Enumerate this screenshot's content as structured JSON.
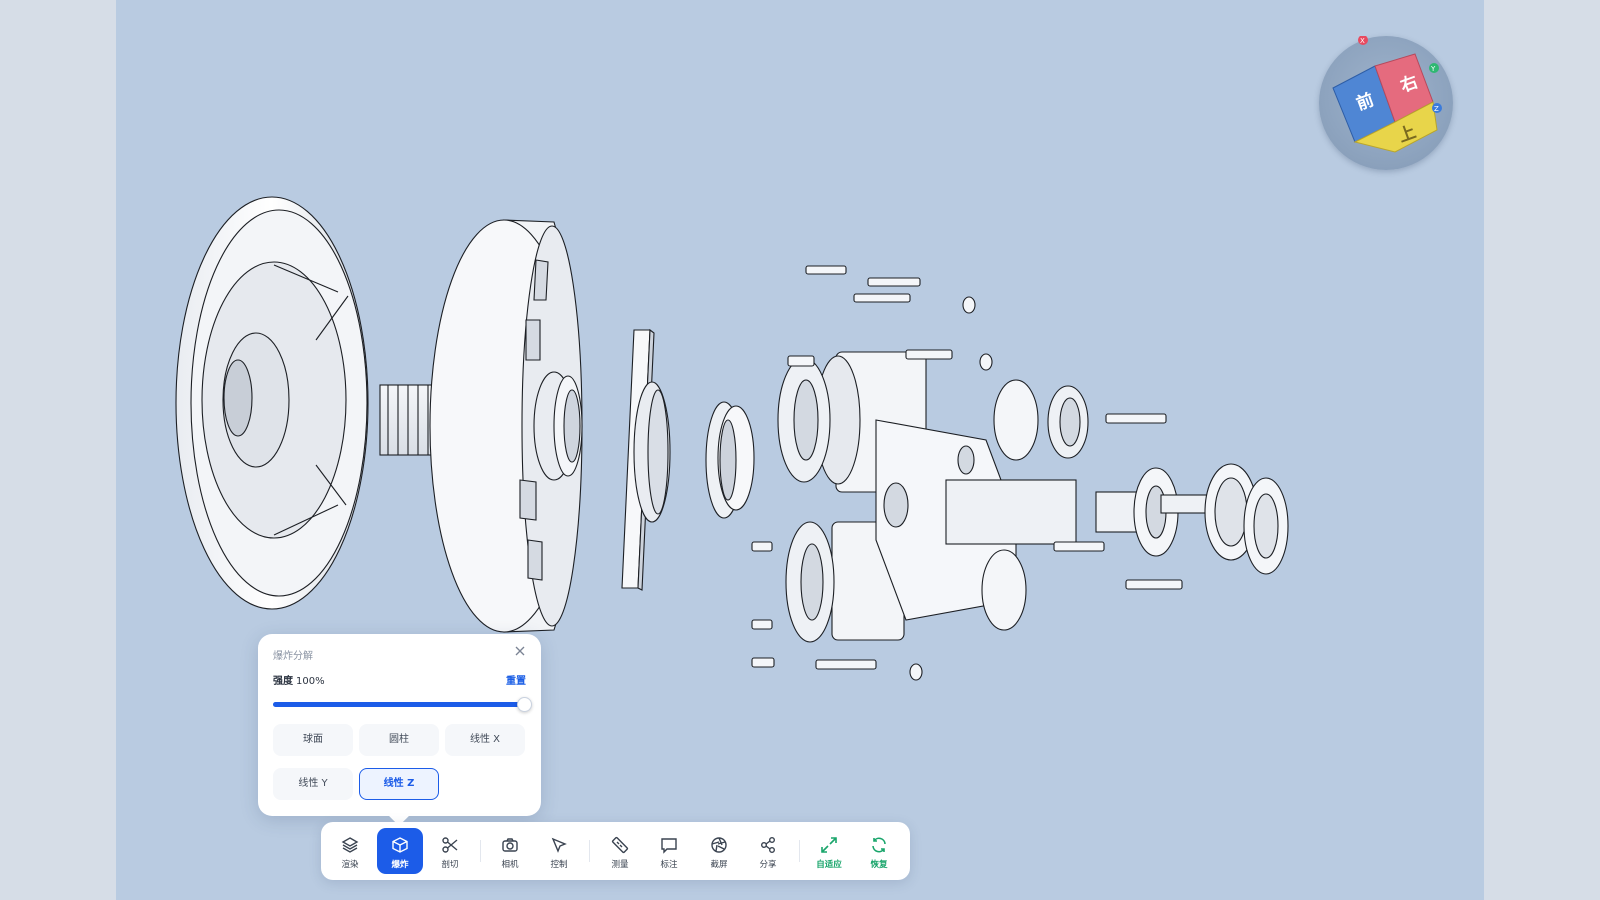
{
  "viewer": {
    "background_color": "#b9cbe1",
    "accent_color": "#1c5ce8",
    "fit_color": "#19a56b"
  },
  "view_cube": {
    "face_front": "前",
    "face_right": "右",
    "face_top": "上",
    "axes": [
      "X",
      "Y",
      "Z"
    ],
    "colors": {
      "front": "#4f86d4",
      "right": "#e56b7e",
      "top": "#e8d54a"
    }
  },
  "explode_panel": {
    "title": "爆炸分解",
    "strength_label": "强度",
    "strength_value": "100%",
    "strength_fraction": 1.0,
    "reset_label": "重置",
    "modes": [
      {
        "id": "sphere",
        "label": "球面",
        "active": false
      },
      {
        "id": "cylinder",
        "label": "圆柱",
        "active": false
      },
      {
        "id": "linear-x",
        "label": "线性 X",
        "active": false
      },
      {
        "id": "linear-y",
        "label": "线性 Y",
        "active": false
      },
      {
        "id": "linear-z",
        "label": "线性 Z",
        "active": true
      }
    ]
  },
  "toolbar": {
    "items": [
      {
        "id": "render",
        "label": "渲染",
        "icon": "layers-icon",
        "active": false
      },
      {
        "id": "explode",
        "label": "爆炸",
        "icon": "cube-icon",
        "active": true
      },
      {
        "id": "section",
        "label": "剖切",
        "icon": "scissors-icon",
        "active": false
      },
      {
        "id": "camera",
        "label": "相机",
        "icon": "camera-icon",
        "active": false
      },
      {
        "id": "control",
        "label": "控制",
        "icon": "pointer-icon",
        "active": false
      },
      {
        "id": "measure",
        "label": "测量",
        "icon": "ruler-icon",
        "active": false
      },
      {
        "id": "annotate",
        "label": "标注",
        "icon": "comment-icon",
        "active": false
      },
      {
        "id": "screenshot",
        "label": "截屏",
        "icon": "aperture-icon",
        "active": false
      },
      {
        "id": "share",
        "label": "分享",
        "icon": "share-icon",
        "active": false
      },
      {
        "id": "fit",
        "label": "自适应",
        "icon": "expand-icon",
        "active": false
      },
      {
        "id": "restore",
        "label": "恢复",
        "icon": "refresh-icon",
        "active": false
      }
    ]
  }
}
